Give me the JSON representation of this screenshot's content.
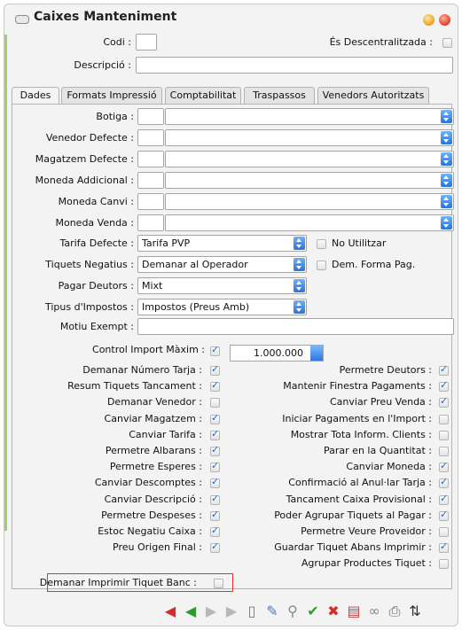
{
  "window": {
    "title": "Caixes Manteniment"
  },
  "header": {
    "codi_label": "Codi :",
    "codi_value": "",
    "descentralitzada_label": "És Descentralitzada :",
    "descentralitzada_checked": false,
    "descripcio_label": "Descripció :",
    "descripcio_value": ""
  },
  "tabs": [
    {
      "label": "Dades",
      "active": true
    },
    {
      "label": "Formats Impressió",
      "active": false
    },
    {
      "label": "Comptabilitat",
      "active": false
    },
    {
      "label": "Traspassos",
      "active": false
    },
    {
      "label": "Venedors Autoritzats",
      "active": false
    }
  ],
  "lookups": [
    {
      "label": "Botiga :",
      "code": "",
      "value": ""
    },
    {
      "label": "Venedor Defecte :",
      "code": "",
      "value": ""
    },
    {
      "label": "Magatzem Defecte :",
      "code": "",
      "value": ""
    },
    {
      "label": "Moneda Addicional :",
      "code": "",
      "value": ""
    },
    {
      "label": "Moneda Canvi :",
      "code": "",
      "value": ""
    },
    {
      "label": "Moneda Venda :",
      "code": "",
      "value": ""
    }
  ],
  "selects": [
    {
      "label": "Tarifa Defecte :",
      "value": "Tarifa PVP"
    },
    {
      "label": "Tiquets Negatius :",
      "value": "Demanar al Operador"
    },
    {
      "label": "Pagar Deutors :",
      "value": "Mixt"
    },
    {
      "label": "Tipus d'Impostos :",
      "value": "Impostos (Preus Amb)"
    }
  ],
  "side_checks": [
    {
      "label": "No Utilitzar",
      "checked": false
    },
    {
      "label": "Dem. Forma Pag.",
      "checked": false
    }
  ],
  "motiu": {
    "label": "Motiu Exempt :",
    "value": ""
  },
  "control_import": {
    "label": "Control Import Màxim :",
    "checked": true,
    "value": "1.000.000"
  },
  "left_checks": [
    {
      "label": "Demanar Número Tarja :",
      "checked": true
    },
    {
      "label": "Resum Tiquets Tancament :",
      "checked": true
    },
    {
      "label": "Demanar Venedor :",
      "checked": false
    },
    {
      "label": "Canviar Magatzem :",
      "checked": true
    },
    {
      "label": "Canviar Tarifa :",
      "checked": true
    },
    {
      "label": "Permetre Albarans :",
      "checked": true
    },
    {
      "label": "Permetre Esperes :",
      "checked": true
    },
    {
      "label": "Canviar Descomptes :",
      "checked": true
    },
    {
      "label": "Canviar Descripció :",
      "checked": true
    },
    {
      "label": "Permetre Despeses :",
      "checked": true
    },
    {
      "label": "Estoc Negatiu Caixa :",
      "checked": true
    },
    {
      "label": "Preu Origen Final :",
      "checked": true
    }
  ],
  "right_checks": [
    {
      "label": "Permetre Deutors :",
      "checked": true
    },
    {
      "label": "Mantenir Finestra Pagaments :",
      "checked": true
    },
    {
      "label": "Canviar Preu Venda :",
      "checked": true
    },
    {
      "label": "Iniciar Pagaments en l'Import :",
      "checked": false
    },
    {
      "label": "Mostrar Tota Inform. Clients :",
      "checked": false
    },
    {
      "label": "Parar en la Quantitat :",
      "checked": false
    },
    {
      "label": "Canviar Moneda :",
      "checked": true
    },
    {
      "label": "Confirmació al Anul·lar Tarja :",
      "checked": true
    },
    {
      "label": "Tancament Caixa Provisional :",
      "checked": true
    },
    {
      "label": "Poder Agrupar Tiquets al Pagar :",
      "checked": true
    },
    {
      "label": "Permetre Veure Proveidor :",
      "checked": false
    },
    {
      "label": "Guardar Tiquet Abans Imprimir :",
      "checked": true
    },
    {
      "label": "Agrupar Productes Tiquet :",
      "checked": false
    }
  ],
  "highlighted_check": {
    "label": "Demanar Imprimir Tiquet Banc :",
    "checked": false
  },
  "toolbar": [
    {
      "icon": "first-icon",
      "glyph": "◀",
      "color": "#d0302a"
    },
    {
      "icon": "previous-icon",
      "glyph": "◀",
      "color": "#2f9a2f"
    },
    {
      "icon": "next-icon",
      "glyph": "▶",
      "color": "#b8b8b8"
    },
    {
      "icon": "last-icon",
      "glyph": "▶",
      "color": "#b8b8b8"
    },
    {
      "icon": "new-document-icon",
      "glyph": "▯",
      "color": "#777777"
    },
    {
      "icon": "edit-icon",
      "glyph": "✎",
      "color": "#4a78c8"
    },
    {
      "icon": "search-icon",
      "glyph": "⚲",
      "color": "#888888"
    },
    {
      "icon": "save-icon",
      "glyph": "✔",
      "color": "#2f9a2f"
    },
    {
      "icon": "delete-icon",
      "glyph": "✖",
      "color": "#d0302a"
    },
    {
      "icon": "book-icon",
      "glyph": "▤",
      "color": "#c04040"
    },
    {
      "icon": "link-icon",
      "glyph": "∞",
      "color": "#8a8a8a"
    },
    {
      "icon": "print-icon",
      "glyph": "⎙",
      "color": "#666666"
    },
    {
      "icon": "sort-icon",
      "glyph": "⇅",
      "color": "#333333"
    }
  ]
}
